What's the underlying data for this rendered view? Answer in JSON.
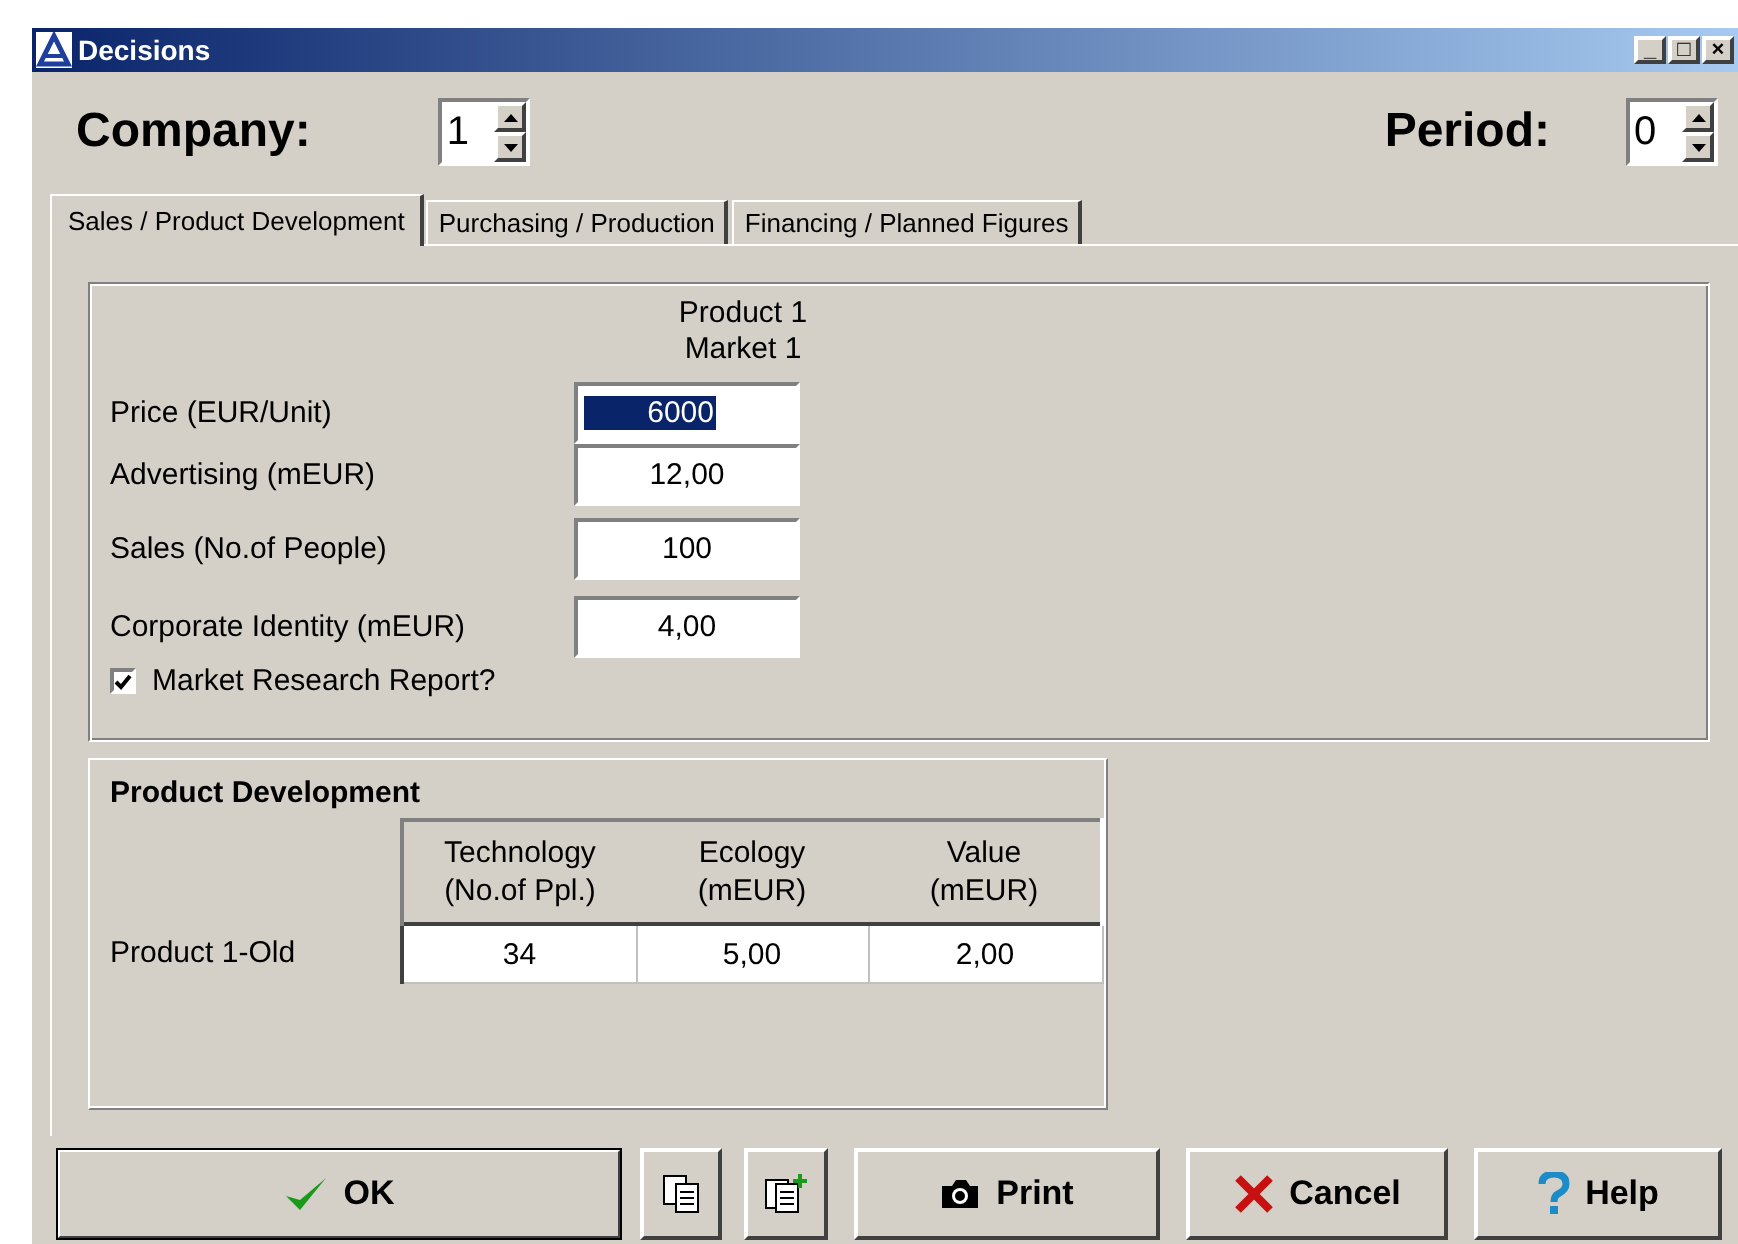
{
  "window": {
    "title": "Decisions",
    "controls": [
      "_",
      "□",
      "×"
    ]
  },
  "header": {
    "company": {
      "label": "Company:",
      "value": "1"
    },
    "period": {
      "label": "Period:",
      "value": "0"
    }
  },
  "tabs": [
    {
      "label": "Sales / Product Development",
      "selected": true
    },
    {
      "label": "Purchasing / Production",
      "selected": false
    },
    {
      "label": "Financing / Planned Figures",
      "selected": false
    }
  ],
  "sales": {
    "column_heading": {
      "product": "Product 1",
      "market": "Market 1"
    },
    "fields": [
      {
        "label": "Price (EUR/Unit)",
        "value": "6000",
        "selected": true
      },
      {
        "label": "Advertising (mEUR)",
        "value": "12,00",
        "selected": false
      },
      {
        "label": "Sales (No.of People)",
        "value": "100",
        "selected": false
      },
      {
        "label": "Corporate Identity (mEUR)",
        "value": "4,00",
        "selected": false
      }
    ],
    "market_research": {
      "label": "Market Research Report?",
      "checked": true
    }
  },
  "product_development": {
    "title": "Product Development",
    "columns": [
      {
        "title": "Technology",
        "unit": "(No.of Ppl.)"
      },
      {
        "title": "Ecology",
        "unit": "(mEUR)"
      },
      {
        "title": "Value",
        "unit": "(mEUR)"
      }
    ],
    "rows": [
      {
        "label": "Product 1-Old",
        "cells": [
          "34",
          "5,00",
          "2,00"
        ]
      }
    ]
  },
  "buttons": [
    {
      "kind": "ok",
      "label": "OK"
    },
    {
      "kind": "copy"
    },
    {
      "kind": "copy-add"
    },
    {
      "kind": "print",
      "label": "Print"
    },
    {
      "kind": "cancel",
      "label": "Cancel"
    },
    {
      "kind": "help",
      "label": "Help"
    }
  ]
}
